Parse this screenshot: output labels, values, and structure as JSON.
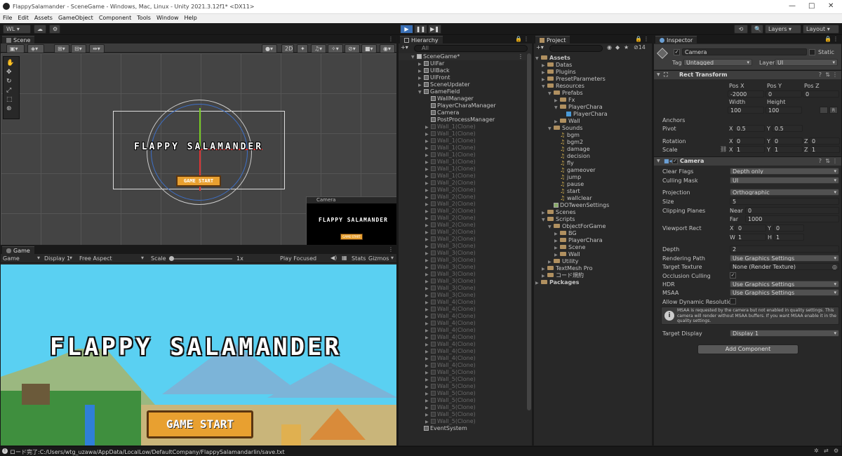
{
  "title_bar": {
    "title": "FlappySalamander - SceneGame - Windows, Mac, Linux - Unity 2021.3.12f1* <DX11>",
    "minimize": "—",
    "maximize": "□",
    "close": "✕"
  },
  "menu": [
    "File",
    "Edit",
    "Assets",
    "GameObject",
    "Component",
    "Tools",
    "Window",
    "Help"
  ],
  "toolbar": {
    "account": "WL ▾",
    "cloud": "☁",
    "play": "▶",
    "pause": "❚❚",
    "step": "▶❚",
    "history": "⟲",
    "search": "🔍",
    "layers": "Layers",
    "layout": "Layout"
  },
  "scene": {
    "tab": "Scene",
    "btn_2d": "2D",
    "title": "FLAPPY SALAMANDER",
    "start": "GAME START",
    "camera_preview": {
      "label": "Camera",
      "title": "FLAPPY SALAMANDER",
      "start": "GAME START"
    }
  },
  "game": {
    "tab": "Game",
    "display_mode": "Game",
    "display": "Display 1",
    "aspect": "Free Aspect",
    "scale_label": "Scale",
    "scale_value": "1x",
    "play_focused": "Play Focused",
    "stats": "Stats",
    "gizmos": "Gizmos",
    "title": "FLAPPY SALAMANDER",
    "start": "GAME START"
  },
  "hierarchy": {
    "tab": "Hierarchy",
    "search_placeholder": "All",
    "items": [
      {
        "label": "SceneGame*",
        "depth": 0,
        "arrow": "▼",
        "kind": "scene"
      },
      {
        "label": "UIFar",
        "depth": 1,
        "arrow": "▶",
        "kind": "obj"
      },
      {
        "label": "UIBack",
        "depth": 1,
        "arrow": "▶",
        "kind": "obj"
      },
      {
        "label": "UIFront",
        "depth": 1,
        "arrow": "▶",
        "kind": "obj"
      },
      {
        "label": "SceneUpdater",
        "depth": 1,
        "arrow": "▶",
        "kind": "obj"
      },
      {
        "label": "GameField",
        "depth": 1,
        "arrow": "▼",
        "kind": "obj"
      },
      {
        "label": "WallManager",
        "depth": 2,
        "arrow": "",
        "kind": "obj"
      },
      {
        "label": "PlayerCharaManager",
        "depth": 2,
        "arrow": "",
        "kind": "obj"
      },
      {
        "label": "Camera",
        "depth": 2,
        "arrow": "",
        "kind": "obj"
      },
      {
        "label": "PostProcessManager",
        "depth": 2,
        "arrow": "",
        "kind": "obj"
      },
      {
        "label": "Wall_1(Clone)",
        "depth": 2,
        "arrow": "▶",
        "kind": "clone"
      },
      {
        "label": "Wall_1(Clone)",
        "depth": 2,
        "arrow": "▶",
        "kind": "clone"
      },
      {
        "label": "Wall_1(Clone)",
        "depth": 2,
        "arrow": "▶",
        "kind": "clone"
      },
      {
        "label": "Wall_1(Clone)",
        "depth": 2,
        "arrow": "▶",
        "kind": "clone"
      },
      {
        "label": "Wall_1(Clone)",
        "depth": 2,
        "arrow": "▶",
        "kind": "clone"
      },
      {
        "label": "Wall_1(Clone)",
        "depth": 2,
        "arrow": "▶",
        "kind": "clone"
      },
      {
        "label": "Wall_1(Clone)",
        "depth": 2,
        "arrow": "▶",
        "kind": "clone"
      },
      {
        "label": "Wall_1(Clone)",
        "depth": 2,
        "arrow": "▶",
        "kind": "clone"
      },
      {
        "label": "Wall_2(Clone)",
        "depth": 2,
        "arrow": "▶",
        "kind": "clone"
      },
      {
        "label": "Wall_2(Clone)",
        "depth": 2,
        "arrow": "▶",
        "kind": "clone"
      },
      {
        "label": "Wall_2(Clone)",
        "depth": 2,
        "arrow": "▶",
        "kind": "clone"
      },
      {
        "label": "Wall_2(Clone)",
        "depth": 2,
        "arrow": "▶",
        "kind": "clone"
      },
      {
        "label": "Wall_2(Clone)",
        "depth": 2,
        "arrow": "▶",
        "kind": "clone"
      },
      {
        "label": "Wall_2(Clone)",
        "depth": 2,
        "arrow": "▶",
        "kind": "clone"
      },
      {
        "label": "Wall_2(Clone)",
        "depth": 2,
        "arrow": "▶",
        "kind": "clone"
      },
      {
        "label": "Wall_2(Clone)",
        "depth": 2,
        "arrow": "▶",
        "kind": "clone"
      },
      {
        "label": "Wall_2(Clone)",
        "depth": 2,
        "arrow": "▶",
        "kind": "clone"
      },
      {
        "label": "Wall_3(Clone)",
        "depth": 2,
        "arrow": "▶",
        "kind": "clone"
      },
      {
        "label": "Wall_3(Clone)",
        "depth": 2,
        "arrow": "▶",
        "kind": "clone"
      },
      {
        "label": "Wall_3(Clone)",
        "depth": 2,
        "arrow": "▶",
        "kind": "clone"
      },
      {
        "label": "Wall_3(Clone)",
        "depth": 2,
        "arrow": "▶",
        "kind": "clone"
      },
      {
        "label": "Wall_3(Clone)",
        "depth": 2,
        "arrow": "▶",
        "kind": "clone"
      },
      {
        "label": "Wall_3(Clone)",
        "depth": 2,
        "arrow": "▶",
        "kind": "clone"
      },
      {
        "label": "Wall_3(Clone)",
        "depth": 2,
        "arrow": "▶",
        "kind": "clone"
      },
      {
        "label": "Wall_3(Clone)",
        "depth": 2,
        "arrow": "▶",
        "kind": "clone"
      },
      {
        "label": "Wall_4(Clone)",
        "depth": 2,
        "arrow": "▶",
        "kind": "clone"
      },
      {
        "label": "Wall_4(Clone)",
        "depth": 2,
        "arrow": "▶",
        "kind": "clone"
      },
      {
        "label": "Wall_4(Clone)",
        "depth": 2,
        "arrow": "▶",
        "kind": "clone"
      },
      {
        "label": "Wall_4(Clone)",
        "depth": 2,
        "arrow": "▶",
        "kind": "clone"
      },
      {
        "label": "Wall_4(Clone)",
        "depth": 2,
        "arrow": "▶",
        "kind": "clone"
      },
      {
        "label": "Wall_4(Clone)",
        "depth": 2,
        "arrow": "▶",
        "kind": "clone"
      },
      {
        "label": "Wall_4(Clone)",
        "depth": 2,
        "arrow": "▶",
        "kind": "clone"
      },
      {
        "label": "Wall_4(Clone)",
        "depth": 2,
        "arrow": "▶",
        "kind": "clone"
      },
      {
        "label": "Wall_4(Clone)",
        "depth": 2,
        "arrow": "▶",
        "kind": "clone"
      },
      {
        "label": "Wall_4(Clone)",
        "depth": 2,
        "arrow": "▶",
        "kind": "clone"
      },
      {
        "label": "Wall_5(Clone)",
        "depth": 2,
        "arrow": "▶",
        "kind": "clone"
      },
      {
        "label": "Wall_5(Clone)",
        "depth": 2,
        "arrow": "▶",
        "kind": "clone"
      },
      {
        "label": "Wall_5(Clone)",
        "depth": 2,
        "arrow": "▶",
        "kind": "clone"
      },
      {
        "label": "Wall_5(Clone)",
        "depth": 2,
        "arrow": "▶",
        "kind": "clone"
      },
      {
        "label": "Wall_5(Clone)",
        "depth": 2,
        "arrow": "▶",
        "kind": "clone"
      },
      {
        "label": "Wall_5(Clone)",
        "depth": 2,
        "arrow": "▶",
        "kind": "clone"
      },
      {
        "label": "Wall_5(Clone)",
        "depth": 2,
        "arrow": "▶",
        "kind": "clone"
      },
      {
        "label": "Wall_5(Clone)",
        "depth": 2,
        "arrow": "▶",
        "kind": "clone"
      },
      {
        "label": "EventSystem",
        "depth": 1,
        "arrow": "",
        "kind": "obj"
      }
    ]
  },
  "project": {
    "tab": "Project",
    "count": "14",
    "items": [
      {
        "label": "Assets",
        "depth": 0,
        "arrow": "▼",
        "kind": "folder",
        "bold": true
      },
      {
        "label": "Datas",
        "depth": 1,
        "arrow": "▶",
        "kind": "folder"
      },
      {
        "label": "Plugins",
        "depth": 1,
        "arrow": "▶",
        "kind": "folder"
      },
      {
        "label": "PresetParameters",
        "depth": 1,
        "arrow": "▶",
        "kind": "folder"
      },
      {
        "label": "Resources",
        "depth": 1,
        "arrow": "▼",
        "kind": "folder"
      },
      {
        "label": "Prefabs",
        "depth": 2,
        "arrow": "▼",
        "kind": "folder"
      },
      {
        "label": "Fx",
        "depth": 3,
        "arrow": "▶",
        "kind": "folder"
      },
      {
        "label": "PlayerChara",
        "depth": 3,
        "arrow": "▼",
        "kind": "folder"
      },
      {
        "label": "PlayerChara",
        "depth": 4,
        "arrow": "",
        "kind": "prefab"
      },
      {
        "label": "Wall",
        "depth": 3,
        "arrow": "▶",
        "kind": "folder"
      },
      {
        "label": "Sounds",
        "depth": 2,
        "arrow": "▼",
        "kind": "folder"
      },
      {
        "label": "bgm",
        "depth": 3,
        "arrow": "",
        "kind": "audio"
      },
      {
        "label": "bgm2",
        "depth": 3,
        "arrow": "",
        "kind": "audio"
      },
      {
        "label": "damage",
        "depth": 3,
        "arrow": "",
        "kind": "audio"
      },
      {
        "label": "decision",
        "depth": 3,
        "arrow": "",
        "kind": "audio"
      },
      {
        "label": "fly",
        "depth": 3,
        "arrow": "",
        "kind": "audio"
      },
      {
        "label": "gameover",
        "depth": 3,
        "arrow": "",
        "kind": "audio"
      },
      {
        "label": "jump",
        "depth": 3,
        "arrow": "",
        "kind": "audio"
      },
      {
        "label": "pause",
        "depth": 3,
        "arrow": "",
        "kind": "audio"
      },
      {
        "label": "start",
        "depth": 3,
        "arrow": "",
        "kind": "audio"
      },
      {
        "label": "wallclear",
        "depth": 3,
        "arrow": "",
        "kind": "audio"
      },
      {
        "label": "DOTweenSettings",
        "depth": 2,
        "arrow": "",
        "kind": "asset"
      },
      {
        "label": "Scenes",
        "depth": 1,
        "arrow": "▶",
        "kind": "folder"
      },
      {
        "label": "Scripts",
        "depth": 1,
        "arrow": "▼",
        "kind": "folder"
      },
      {
        "label": "ObjectForGame",
        "depth": 2,
        "arrow": "▼",
        "kind": "folder"
      },
      {
        "label": "BG",
        "depth": 3,
        "arrow": "▶",
        "kind": "folder"
      },
      {
        "label": "PlayerChara",
        "depth": 3,
        "arrow": "▶",
        "kind": "folder"
      },
      {
        "label": "Scene",
        "depth": 3,
        "arrow": "▶",
        "kind": "folder"
      },
      {
        "label": "Wall",
        "depth": 3,
        "arrow": "▶",
        "kind": "folder"
      },
      {
        "label": "Utility",
        "depth": 2,
        "arrow": "▶",
        "kind": "folder"
      },
      {
        "label": "TextMesh Pro",
        "depth": 1,
        "arrow": "▶",
        "kind": "folder"
      },
      {
        "label": "コード規約",
        "depth": 1,
        "arrow": "▶",
        "kind": "folder"
      },
      {
        "label": "Packages",
        "depth": 0,
        "arrow": "▶",
        "kind": "folder",
        "bold": true
      }
    ]
  },
  "inspector": {
    "tab": "Inspector",
    "name": "Camera",
    "static_label": "Static",
    "tag_label": "Tag",
    "tag": "Untagged",
    "layer_label": "Layer",
    "layer": "UI",
    "rect_transform": {
      "header": "Rect Transform",
      "pos_x_label": "Pos X",
      "pos_y_label": "Pos Y",
      "pos_z_label": "Pos Z",
      "pos_x": "-2000",
      "pos_y": "0",
      "pos_z": "0",
      "width_label": "Width",
      "height_label": "Height",
      "width": "100",
      "height": "100",
      "r_btn": "R",
      "anchors_label": "Anchors",
      "pivot_label": "Pivot",
      "pivot_x": "0.5",
      "pivot_y": "0.5",
      "rotation_label": "Rotation",
      "rot_x": "0",
      "rot_y": "0",
      "rot_z": "0",
      "scale_label": "Scale",
      "scale_x": "1",
      "scale_y": "1",
      "scale_z": "1",
      "x": "X",
      "y": "Y",
      "z": "Z"
    },
    "camera": {
      "header": "Camera",
      "clear_flags_label": "Clear Flags",
      "clear_flags": "Depth only",
      "culling_mask_label": "Culling Mask",
      "culling_mask": "UI",
      "projection_label": "Projection",
      "projection": "Orthographic",
      "size_label": "Size",
      "size": "5",
      "clipping_label": "Clipping Planes",
      "near_label": "Near",
      "near": "0",
      "far_label": "Far",
      "far": "1000",
      "viewport_label": "Viewport Rect",
      "vx": "0",
      "vy": "0",
      "vw": "1",
      "vh": "1",
      "w": "W",
      "h": "H",
      "depth_label": "Depth",
      "depth": "2",
      "rendering_path_label": "Rendering Path",
      "rendering_path": "Use Graphics Settings",
      "target_texture_label": "Target Texture",
      "target_texture": "None (Render Texture)",
      "occlusion_label": "Occlusion Culling",
      "occlusion_check": "✓",
      "hdr_label": "HDR",
      "hdr": "Use Graphics Settings",
      "msaa_label": "MSAA",
      "msaa": "Use Graphics Settings",
      "dynres_label": "Allow Dynamic Resolution",
      "warning": "MSAA is requested by the camera but not enabled in quality settings. This camera will render without MSAA buffers. If you want MSAA enable it in the quality settings.",
      "target_display_label": "Target Display",
      "target_display": "Display 1"
    },
    "add_component": "Add Component"
  },
  "status": {
    "text": "ロード完了:C:/Users/wtg_uzawa/AppData/LocalLow/DefaultCompany/FlappySalamandarlin/save.txt"
  },
  "colors": {
    "sky": "#5ad0f2",
    "title_fill": "#ffffff",
    "button": "#e8a030",
    "accent_blue": "#3d6fc7"
  }
}
